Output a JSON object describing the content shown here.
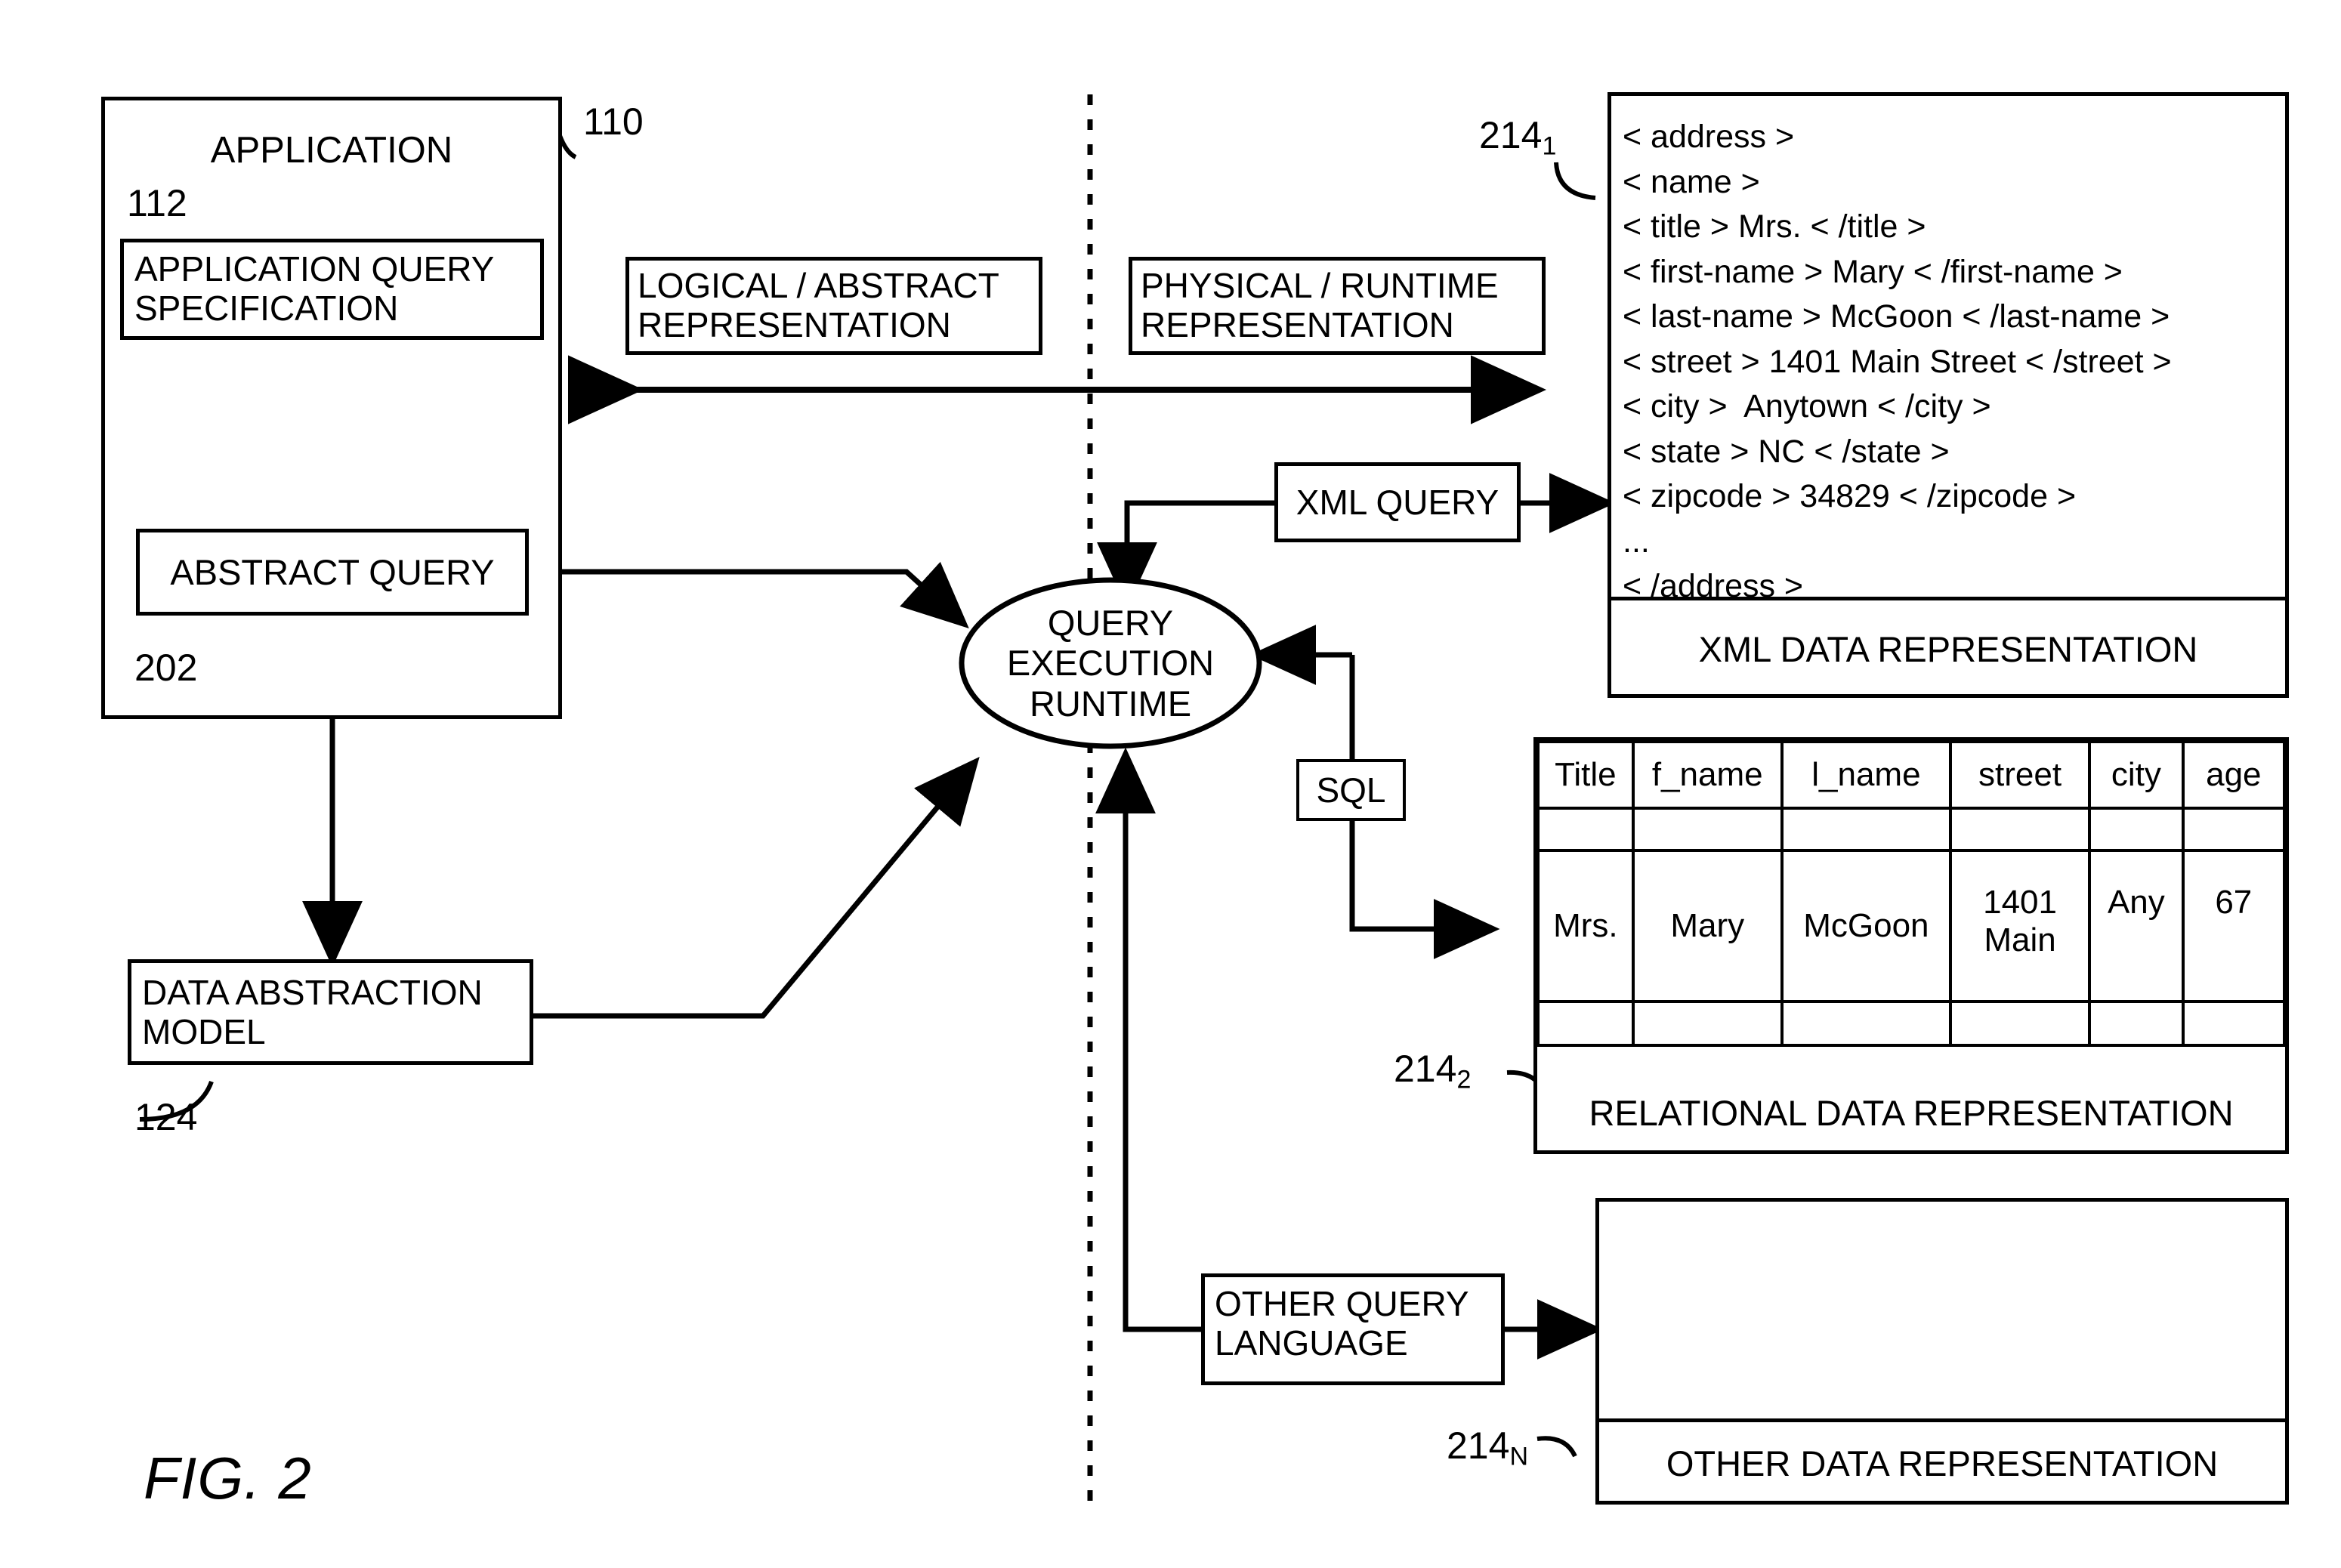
{
  "figure": {
    "caption": "FIG. 2",
    "divider_label_left": "LOGICAL / ABSTRACT\nREPRESENTATION",
    "divider_label_right": "PHYSICAL / RUNTIME\nREPRESENTATION"
  },
  "left": {
    "application_label": "APPLICATION",
    "application_ref": "110",
    "query_spec_label": "APPLICATION QUERY\nSPECIFICATION",
    "query_spec_ref": "112",
    "abstract_query_label": "ABSTRACT QUERY",
    "abstract_query_ref": "202",
    "data_abstraction_label": "DATA ABSTRACTION\nMODEL",
    "data_abstraction_ref": "124"
  },
  "center": {
    "runtime_line1": "QUERY",
    "runtime_line2": "EXECUTION",
    "runtime_line3": "RUNTIME"
  },
  "queries": {
    "xml_query": "XML QUERY",
    "sql": "SQL",
    "other_query_language": "OTHER QUERY\nLANGUAGE"
  },
  "xml_rep": {
    "ref": "214",
    "ref_sub": "1",
    "caption": "XML DATA REPRESENTATION",
    "lines": [
      "< address >",
      "< name >",
      "< title > Mrs. < /title >",
      "< first-name > Mary < /first-name >",
      "< last-name > McGoon < /last-name >",
      "< street > 1401 Main Street < /street >",
      "< city >  Anytown < /city >",
      "< state > NC < /state >",
      "< zipcode > 34829 < /zipcode >",
      "...",
      "< /address >"
    ],
    "text": "< address >\n< name >\n< title > Mrs. < /title >\n< first-name > Mary < /first-name >\n< last-name > McGoon < /last-name >\n< street > 1401 Main Street < /street >\n< city >  Anytown < /city >\n< state > NC < /state >\n< zipcode > 34829 < /zipcode >\n...\n< /address >"
  },
  "relational_rep": {
    "ref": "214",
    "ref_sub": "2",
    "caption": "RELATIONAL DATA REPRESENTATION",
    "columns": [
      "Title",
      "f_name",
      "l_name",
      "street",
      "city",
      "age"
    ],
    "rows": [
      [
        "",
        "",
        "",
        "",
        "",
        ""
      ],
      [
        "Mrs.",
        "Mary",
        "McGoon",
        "1401\nMain",
        "Any",
        "67"
      ],
      [
        "",
        "",
        "",
        "",
        "",
        ""
      ]
    ]
  },
  "other_rep": {
    "ref": "214",
    "ref_sub": "N",
    "caption": "OTHER DATA REPRESENTATION"
  }
}
